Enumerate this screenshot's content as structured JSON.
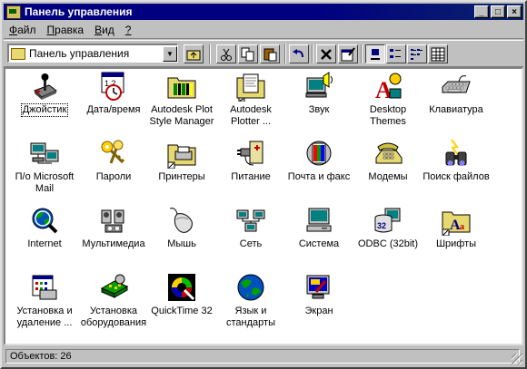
{
  "window": {
    "title": "Панель управления"
  },
  "titlebar_buttons": {
    "minimize": "_",
    "maximize": "□",
    "close": "×"
  },
  "menu": [
    {
      "label": "Файл",
      "underline": "Ф",
      "rest": "айл"
    },
    {
      "label": "Правка",
      "underline": "П",
      "rest": "равка"
    },
    {
      "label": "Вид",
      "underline": "В",
      "rest": "ид"
    },
    {
      "label": "?",
      "underline": "?",
      "rest": ""
    }
  ],
  "address": {
    "value": "Панель управления"
  },
  "toolbar_icons": [
    "up-folder-icon",
    "cut-icon",
    "copy-icon",
    "paste-icon",
    "undo-icon",
    "delete-icon",
    "properties-icon",
    "large-icons-view-icon",
    "small-icons-view-icon",
    "list-view-icon",
    "details-view-icon"
  ],
  "items": [
    {
      "label": "Джойстик",
      "icon": "joystick-icon"
    },
    {
      "label": "Дата/время",
      "icon": "calendar-clock-icon"
    },
    {
      "label": "Autodesk Plot Style Manager",
      "icon": "plot-style-folder-icon"
    },
    {
      "label": "Autodesk Plotter ...",
      "icon": "plotter-folder-icon"
    },
    {
      "label": "Звук",
      "icon": "speaker-icon"
    },
    {
      "label": "Desktop Themes",
      "icon": "desktop-themes-icon"
    },
    {
      "label": "Клавиатура",
      "icon": "keyboard-icon"
    },
    {
      "label": "П/о Microsoft Mail",
      "icon": "mail-postoffice-icon"
    },
    {
      "label": "Пароли",
      "icon": "keys-icon"
    },
    {
      "label": "Принтеры",
      "icon": "printer-folder-icon"
    },
    {
      "label": "Питание",
      "icon": "power-plug-icon"
    },
    {
      "label": "Почта и факс",
      "icon": "mail-fax-icon"
    },
    {
      "label": "Модемы",
      "icon": "telephone-icon"
    },
    {
      "label": "Поиск файлов",
      "icon": "binoculars-icon"
    },
    {
      "label": "Internet",
      "icon": "globe-magnifier-icon"
    },
    {
      "label": "Мультимедиа",
      "icon": "multimedia-icon"
    },
    {
      "label": "Мышь",
      "icon": "mouse-icon"
    },
    {
      "label": "Сеть",
      "icon": "network-icon"
    },
    {
      "label": "Система",
      "icon": "computer-icon"
    },
    {
      "label": "ODBC (32bit)",
      "icon": "odbc-icon"
    },
    {
      "label": "Шрифты",
      "icon": "fonts-folder-icon"
    },
    {
      "label": "Установка и удаление ...",
      "icon": "add-remove-programs-icon"
    },
    {
      "label": "Установка оборудования",
      "icon": "add-hardware-icon"
    },
    {
      "label": "QuickTime 32",
      "icon": "quicktime-icon"
    },
    {
      "label": "Язык и стандарты",
      "icon": "regional-globe-icon"
    },
    {
      "label": "Экран",
      "icon": "display-icon"
    }
  ],
  "status": {
    "text": "Объектов: 26"
  }
}
